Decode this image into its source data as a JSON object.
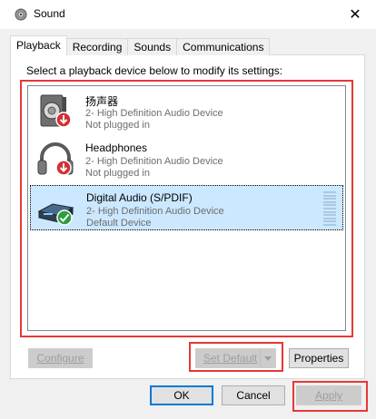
{
  "window": {
    "title": "Sound",
    "close_glyph": "✕",
    "icon": "speaker-icon"
  },
  "tabs": [
    {
      "label": "Playback",
      "active": true
    },
    {
      "label": "Recording",
      "active": false
    },
    {
      "label": "Sounds",
      "active": false
    },
    {
      "label": "Communications",
      "active": false
    }
  ],
  "instruction": "Select a playback device below to modify its settings:",
  "devices": [
    {
      "name": "扬声器",
      "driver": "2- High Definition Audio Device",
      "status": "Not plugged in",
      "icon": "speaker-icon",
      "badge": "red-down-arrow-icon",
      "selected": false
    },
    {
      "name": "Headphones",
      "driver": "2- High Definition Audio Device",
      "status": "Not plugged in",
      "icon": "headphones-icon",
      "badge": "red-down-arrow-icon",
      "selected": false
    },
    {
      "name": "Digital Audio (S/PDIF)",
      "driver": "2- High Definition Audio Device",
      "status": "Default Device",
      "icon": "digital-audio-receiver-icon",
      "badge": "green-check-icon",
      "selected": true
    }
  ],
  "buttons": {
    "configure": "Configure",
    "set_default": "Set Default",
    "properties": "Properties",
    "ok": "OK",
    "cancel": "Cancel",
    "apply": "Apply"
  },
  "colors": {
    "selection": "#cce8ff",
    "highlight_border": "#e53935",
    "badge_red": "#d32f2f",
    "badge_green": "#2e9d3e"
  }
}
